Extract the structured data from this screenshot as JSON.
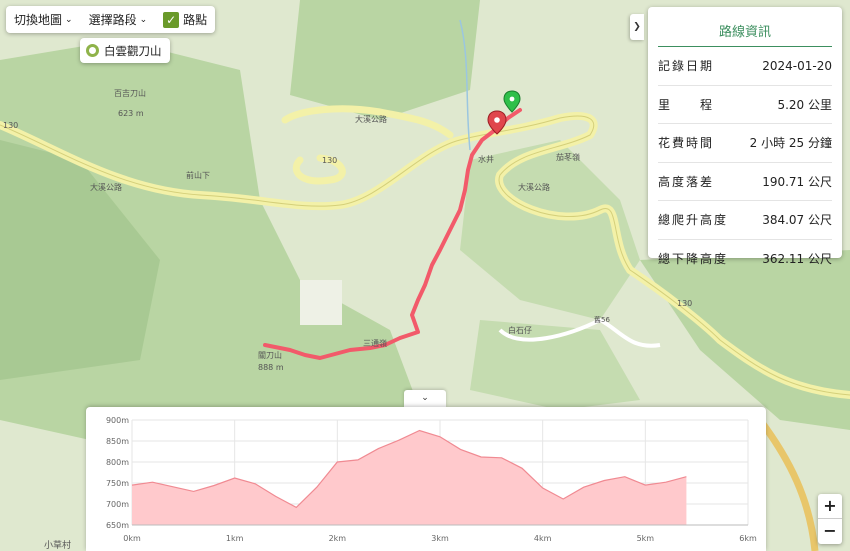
{
  "toolbar": {
    "switch_map": "切換地圖",
    "select_route": "選擇路段",
    "waypoint_label": "路點",
    "waypoint_checked": true
  },
  "trail_chip": {
    "label": "白雲觀刀山"
  },
  "info_panel": {
    "title": "路線資訊",
    "rows": [
      {
        "label": "記錄日期",
        "value": "2024-01-20"
      },
      {
        "label": "里　　程",
        "value": "5.20 公里"
      },
      {
        "label": "花費時間",
        "value": "2 小時 25 分鐘"
      },
      {
        "label": "高度落差",
        "value": "190.71 公尺"
      },
      {
        "label": "總爬升高度",
        "value": "384.07 公尺"
      },
      {
        "label": "總下降高度",
        "value": "362.11 公尺"
      }
    ]
  },
  "map_labels": {
    "road_130": "130",
    "road_name": "大溪公路",
    "peak_left_name": "百吉刀山",
    "peak_left_elev": "623 m",
    "peak_main_name": "關刀山",
    "peak_main_elev": "888 m",
    "place_a": "前山下",
    "place_b": "水井",
    "place_c": "舊56",
    "place_d": "白石仔",
    "place_e": "小草村",
    "place_f": "三通嶺",
    "place_g": "茄苳嶺"
  },
  "colors": {
    "track": "#f25a6a",
    "start_marker": "#2fbf4a",
    "end_marker": "#e0464c",
    "road": "#f3f1a8",
    "forest": "#b9d5a3",
    "elevation_fill": "#ffc9cc",
    "elevation_line": "#f08a92",
    "info_accent": "#3c8f5f"
  },
  "chart_data": {
    "type": "area",
    "x_unit": "km",
    "y_unit": "m",
    "x_ticks": [
      "0km",
      "1km",
      "2km",
      "3km",
      "4km",
      "5km",
      "6km"
    ],
    "y_ticks": [
      "650m",
      "700m",
      "750m",
      "800m",
      "850m",
      "900m"
    ],
    "xlim": [
      0,
      6
    ],
    "ylim": [
      650,
      900
    ],
    "grid": true,
    "x": [
      0,
      0.2,
      0.4,
      0.6,
      0.8,
      1.0,
      1.2,
      1.4,
      1.6,
      1.8,
      2.0,
      2.2,
      2.4,
      2.6,
      2.8,
      3.0,
      3.2,
      3.4,
      3.6,
      3.8,
      4.0,
      4.2,
      4.4,
      4.6,
      4.8,
      5.0,
      5.2,
      5.4
    ],
    "values": [
      745,
      752,
      741,
      730,
      744,
      762,
      748,
      718,
      692,
      740,
      800,
      805,
      832,
      852,
      875,
      860,
      830,
      812,
      810,
      785,
      738,
      712,
      740,
      756,
      765,
      745,
      752,
      765
    ]
  }
}
